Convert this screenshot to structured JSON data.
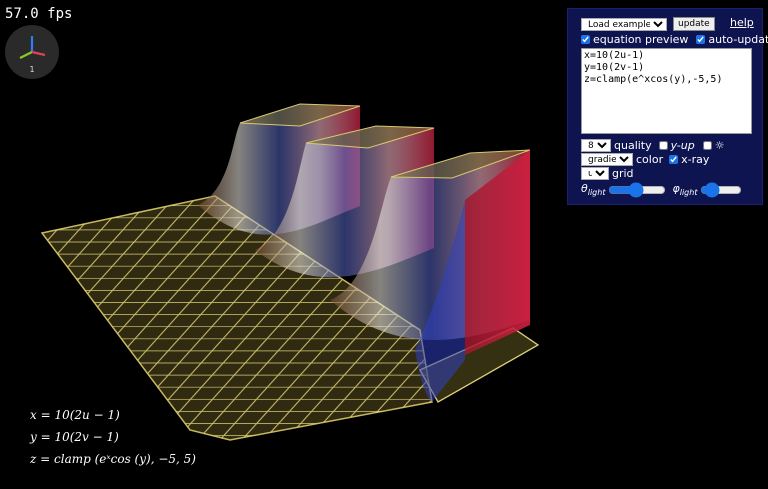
{
  "fps": "57.0 fps",
  "axes_gizmo": {
    "label": "1",
    "colors": {
      "x": "#e0405a",
      "y": "#8ac926",
      "z": "#2f7df6"
    }
  },
  "controls": {
    "example_select": "Load example...",
    "update_button": "update",
    "help_link": "help",
    "equation_preview": {
      "label": "equation preview",
      "checked": true
    },
    "auto_update": {
      "label": "auto-update",
      "checked": true
    },
    "equation_text": "x=10(2u-1)\ny=10(2v-1)\nz=clamp(e^xcos(y),-5,5)",
    "quality_select": "8×",
    "quality_label": "quality",
    "y_up": {
      "label": "y-up",
      "checked": false
    },
    "light": {
      "label": "☼",
      "checked": false
    },
    "color_select": "gradient",
    "color_label": "color",
    "xray": {
      "label": "x-ray",
      "checked": true
    },
    "grid_select": "uv",
    "grid_label": "grid",
    "theta_label": "θ",
    "theta_sub": "light",
    "phi_label": "φ",
    "phi_sub": "light",
    "theta_value": 0.47,
    "phi_value": 0.12
  },
  "preview": {
    "line1": "x = 10(2u − 1)",
    "line2": "y = 10(2v − 1)",
    "line3": "z = clamp (eˣcos (y), −5, 5)"
  },
  "plot_colors": {
    "floor": "#c8b860",
    "wall_warm": "#e0304a",
    "wall_cool": "#3050d0",
    "wall_light": "#f2efe6"
  }
}
